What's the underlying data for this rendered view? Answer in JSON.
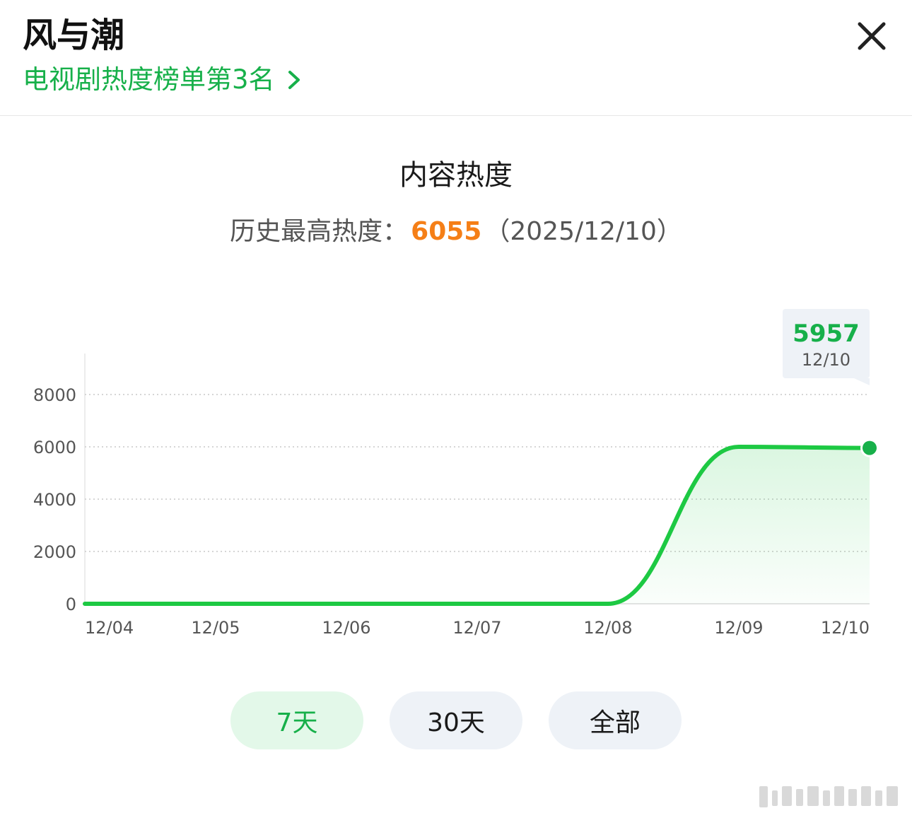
{
  "header": {
    "title": "风与潮",
    "rank_text": "电视剧热度榜单第3名"
  },
  "chart_section": {
    "title": "内容热度",
    "peak_label": "历史最高热度：",
    "peak_value": "6055",
    "peak_date": "（2025/12/10）"
  },
  "tooltip": {
    "value": "5957",
    "date": "12/10"
  },
  "range_tabs": [
    {
      "label": "7天",
      "active": true
    },
    {
      "label": "30天",
      "active": false
    },
    {
      "label": "全部",
      "active": false
    }
  ],
  "colors": {
    "accent": "#17b04a",
    "peak": "#f57f17",
    "line": "#1dc943"
  },
  "chart_data": {
    "type": "area",
    "x": [
      "12/04",
      "12/05",
      "12/06",
      "12/07",
      "12/08",
      "12/09",
      "12/10"
    ],
    "series": [
      {
        "values": [
          0,
          0,
          0,
          0,
          0,
          6000,
          5957
        ]
      }
    ],
    "yticks": [
      0,
      2000,
      4000,
      6000,
      8000
    ],
    "ylim": [
      0,
      8000
    ],
    "grid": true,
    "highlight_point": {
      "x": "12/10",
      "y": 5957
    }
  }
}
